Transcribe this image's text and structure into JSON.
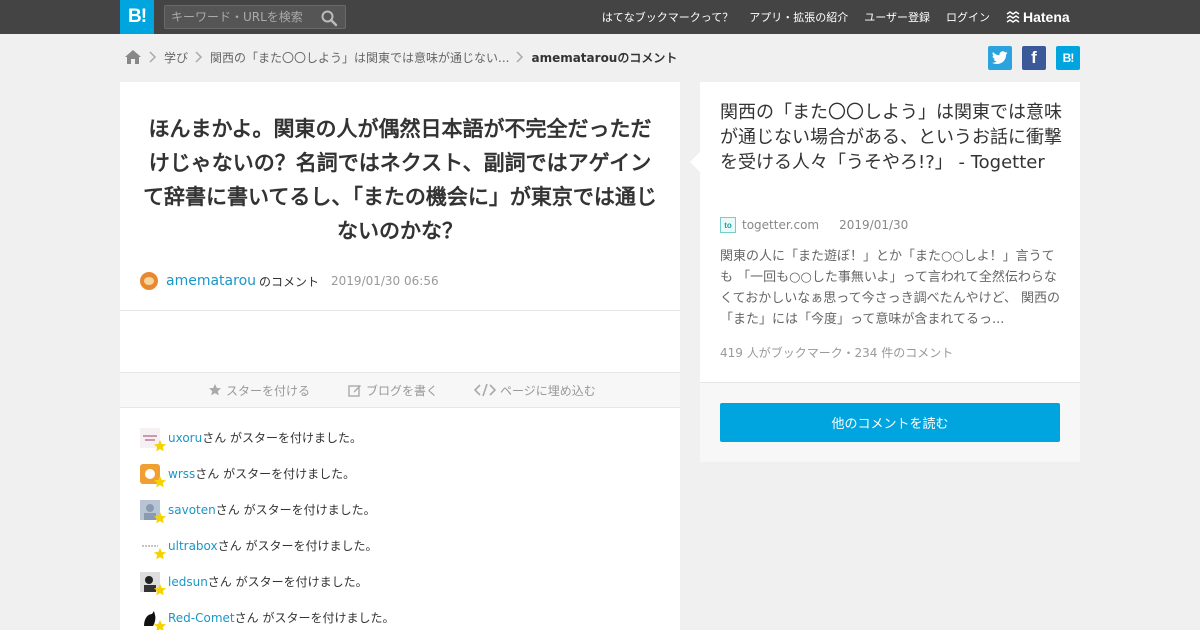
{
  "header": {
    "logo_text": "B!",
    "search_placeholder": "キーワード・URLを検索",
    "nav": [
      {
        "label": "はてなブックマークって？"
      },
      {
        "label": "アプリ・拡張の紹介"
      },
      {
        "label": "ユーザー登録"
      },
      {
        "label": "ログイン"
      }
    ],
    "brand": "Hatena"
  },
  "breadcrumb": {
    "items": [
      "学び",
      "関西の「また〇〇しよう」は関東では意味が通じない..."
    ],
    "current": "amematarouのコメント"
  },
  "share": {
    "hatena_label": "B!",
    "facebook_label": "f"
  },
  "comment": {
    "text": "ほんまかよ。関東の人が偶然日本語が不完全だっただけじゃないの？名詞ではネクスト、副詞ではアゲインて辞書に書いてるし、「またの機会に」が東京では通じないのかな？",
    "author": "amematarou",
    "author_suffix": "のコメント",
    "date": "2019/01/30 06:56"
  },
  "actions": {
    "star": "スターを付ける",
    "blog": "ブログを書く",
    "embed": "ページに埋め込む"
  },
  "stars": [
    {
      "user": "uxoru",
      "suffix": "さん がスターを付けました。"
    },
    {
      "user": "wrss",
      "suffix": "さん がスターを付けました。"
    },
    {
      "user": "savoten",
      "suffix": "さん がスターを付けました。"
    },
    {
      "user": "ultrabox",
      "suffix": "さん がスターを付けました。"
    },
    {
      "user": "ledsun",
      "suffix": "さん がスターを付けました。"
    },
    {
      "user": "Red-Comet",
      "suffix": "さん がスターを付けました。"
    }
  ],
  "entry": {
    "title": "関西の「また〇〇しよう」は関東では意味が通じない場合がある、というお話に衝撃を受ける人々「うそやろ!?」 - Togetter",
    "favicon_text": "to",
    "domain": "togetter.com",
    "date": "2019/01/30",
    "summary": "関東の人に「また遊ぼ！」とか「また○○しよ！」言うても 「一回も○○した事無いよ」って言われて全然伝わらなくておかしいなぁ思って今さっき調べたんやけど、 関西の「また」には「今度」って意味が含まれてるっ...",
    "counts": "419 人がブックマーク・234 件のコメント",
    "read_more": "他のコメントを読む"
  },
  "colors": {
    "header_bg": "#444444",
    "accent": "#00a4de",
    "link": "#1a96c8",
    "star": "#f6d300",
    "twitter": "#2aa3de",
    "facebook": "#3b5998"
  }
}
